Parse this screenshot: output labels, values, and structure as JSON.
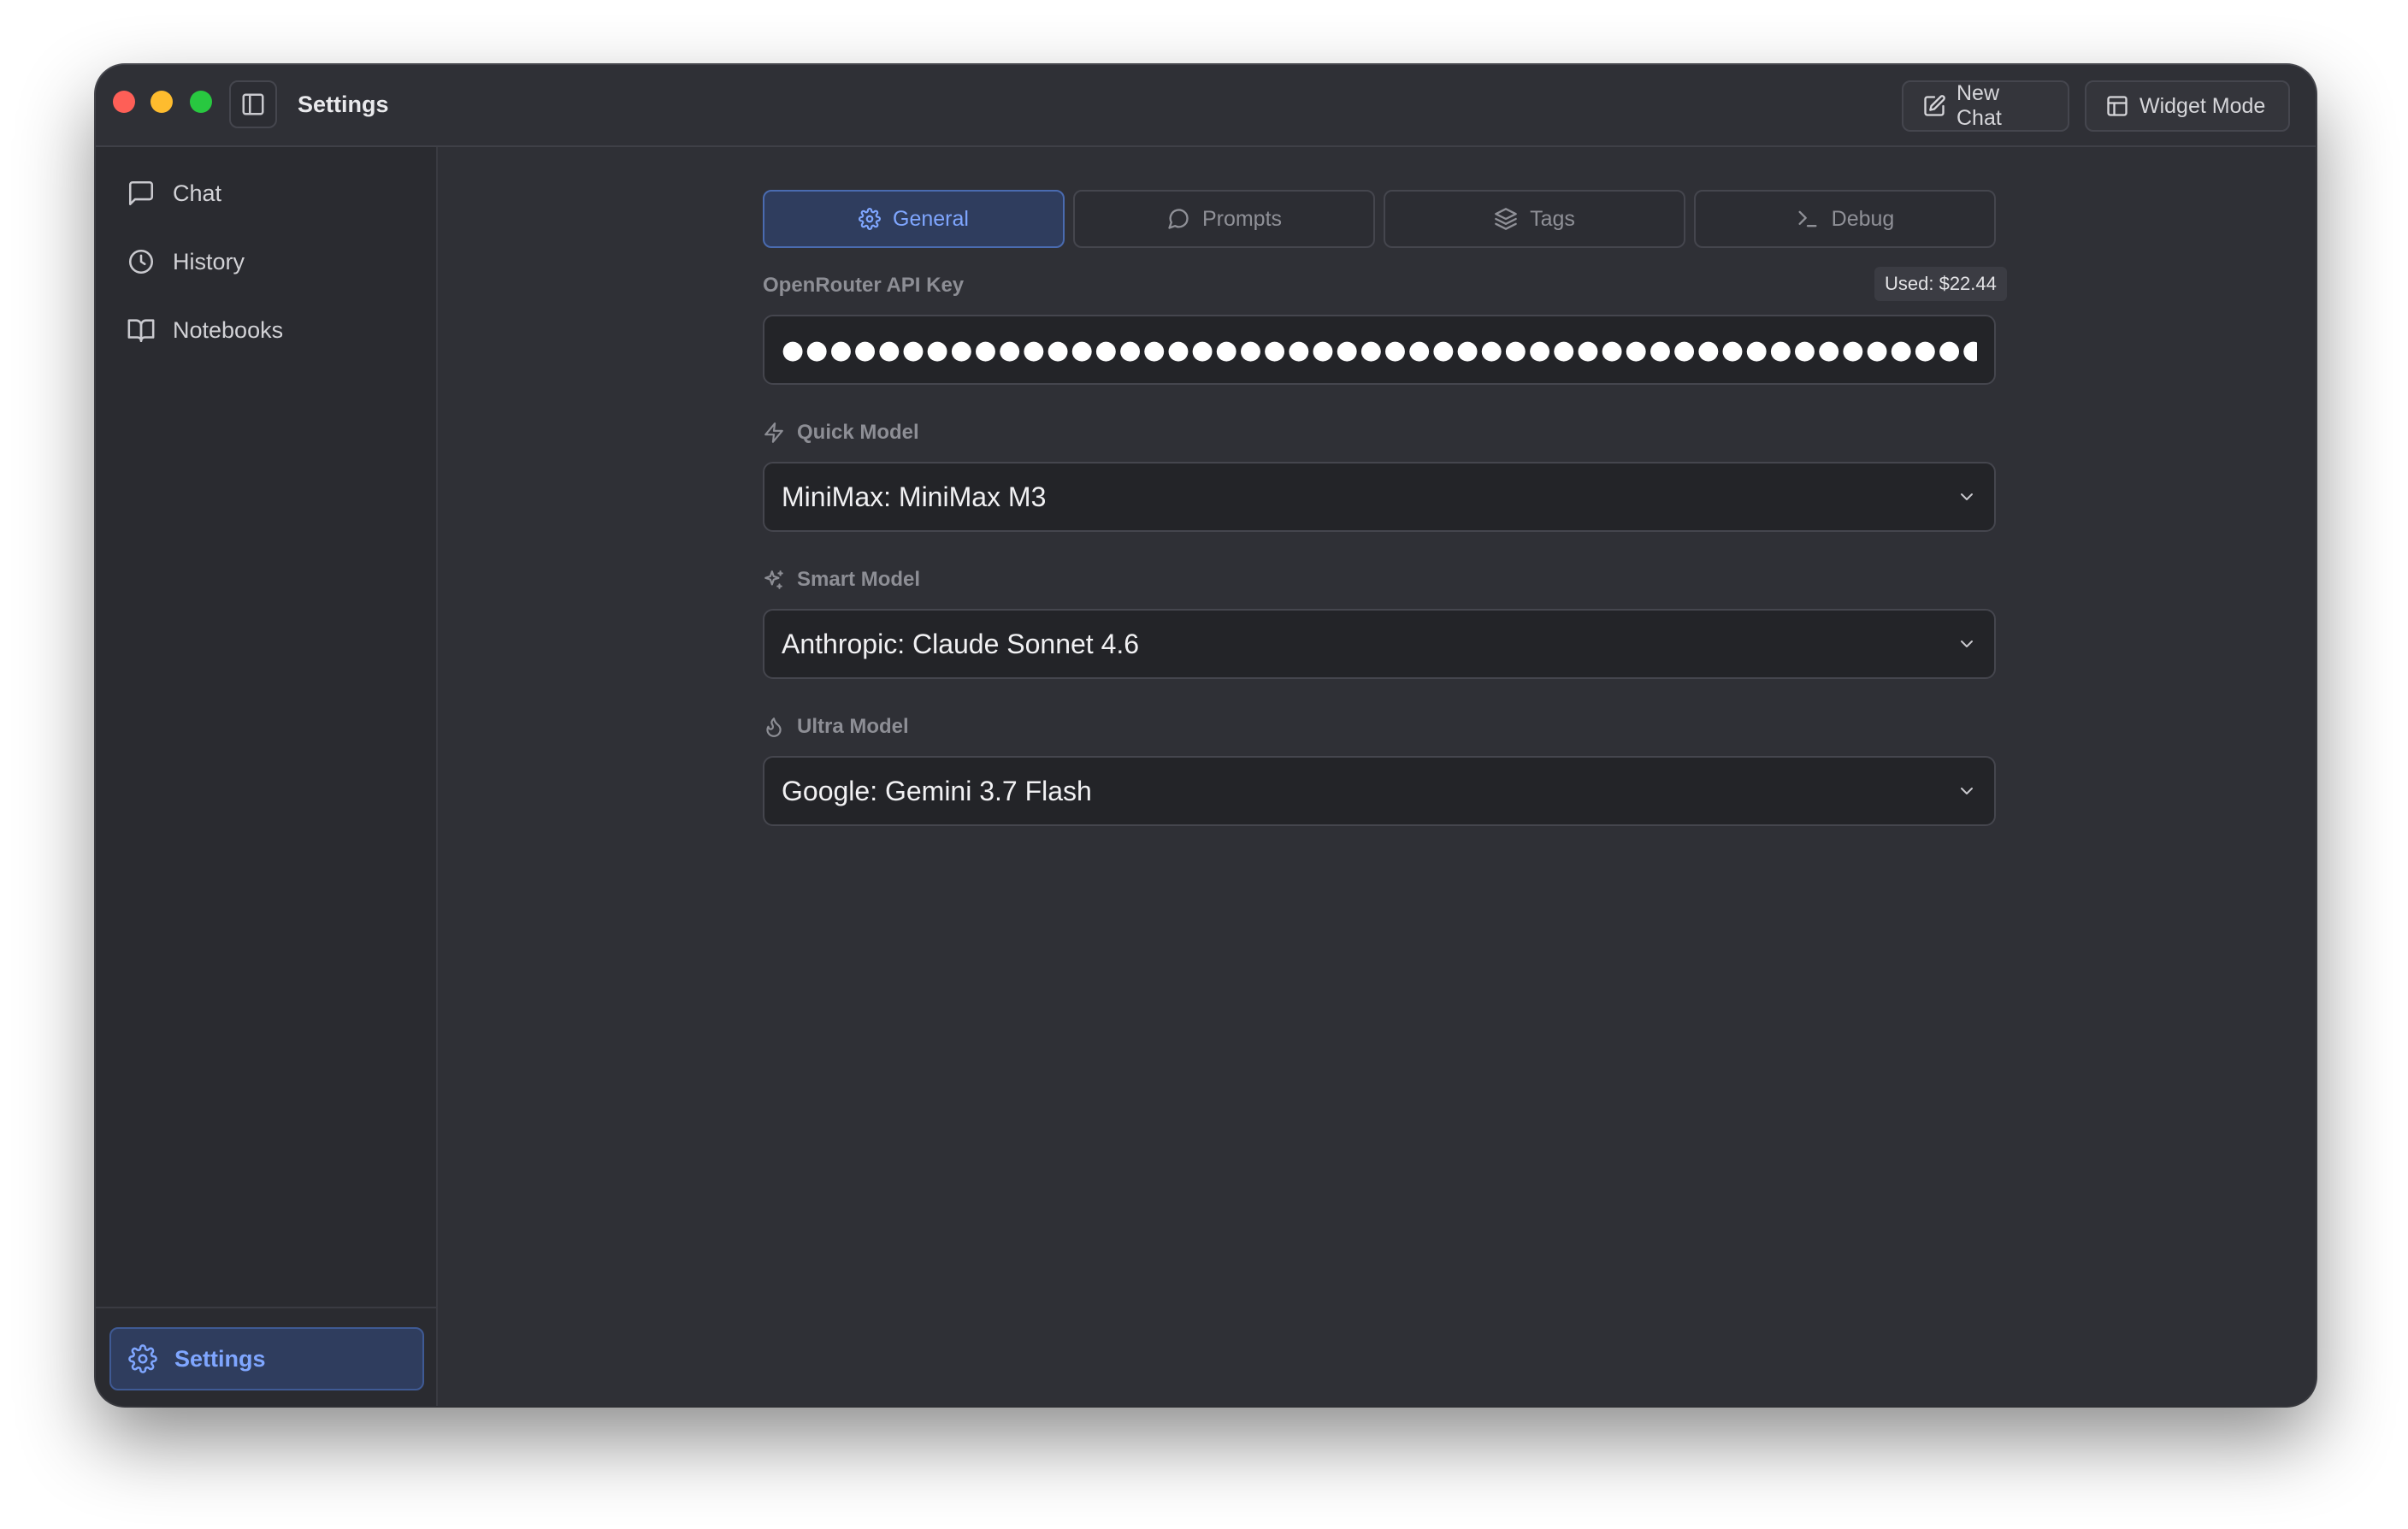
{
  "window": {
    "title": "Settings"
  },
  "toolbar": {
    "new_chat_label": "New Chat",
    "widget_mode_label": "Widget Mode"
  },
  "sidebar": {
    "items": [
      {
        "label": "Chat",
        "icon": "message-square-icon"
      },
      {
        "label": "History",
        "icon": "clock-icon"
      },
      {
        "label": "Notebooks",
        "icon": "book-open-icon"
      }
    ],
    "settings_label": "Settings"
  },
  "tabs": [
    {
      "label": "General",
      "icon": "gear-icon",
      "active": true
    },
    {
      "label": "Prompts",
      "icon": "chat-bubble-icon",
      "active": false
    },
    {
      "label": "Tags",
      "icon": "layers-icon",
      "active": false
    },
    {
      "label": "Debug",
      "icon": "terminal-icon",
      "active": false
    }
  ],
  "api_key": {
    "label": "OpenRouter API Key",
    "usage": "Used: $22.44",
    "masked_value": "●●●●●●●●●●●●●●●●●●●●●●●●●●●●●●●●●●●●●●●●●●●●●●●●●●●●●●●●●●●●●●●●●●●●●●●●●"
  },
  "models": {
    "quick": {
      "label": "Quick Model",
      "value": "MiniMax: MiniMax M3",
      "icon": "zap-icon"
    },
    "smart": {
      "label": "Smart Model",
      "value": "Anthropic: Claude Sonnet 4.6",
      "icon": "sparkles-icon"
    },
    "ultra": {
      "label": "Ultra Model",
      "value": "Google: Gemini 3.7 Flash",
      "icon": "flame-icon"
    }
  },
  "colors": {
    "accent": "#7fa6ff",
    "window_bg": "#2f3036",
    "sidebar_bg": "#2a2b30",
    "input_bg": "#232428"
  }
}
